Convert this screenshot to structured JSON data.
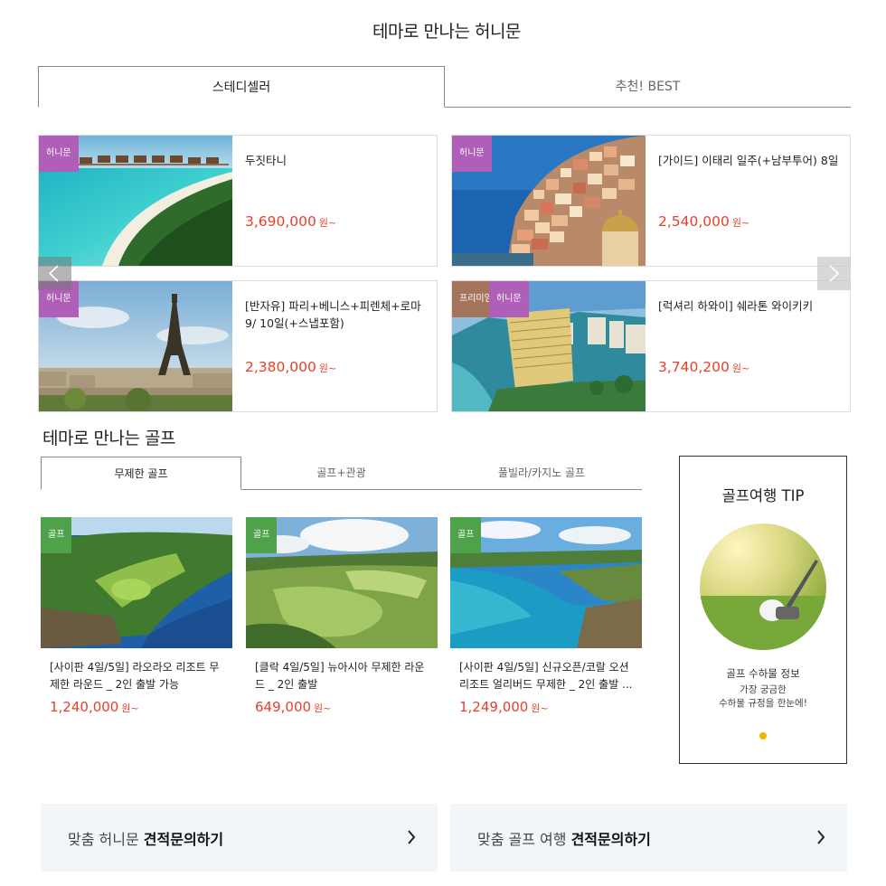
{
  "honeymoon": {
    "title": "테마로 만나는 허니문",
    "tabs": [
      "스테디셀러",
      "추천! BEST"
    ],
    "cards": [
      {
        "badges": [
          "허니문"
        ],
        "title": "두짓타니",
        "price": "3,690,000",
        "won": "원~"
      },
      {
        "badges": [
          "허니문"
        ],
        "title": "[가이드] 이태리 일주(+남부투어) 8일",
        "price": "2,540,000",
        "won": "원~"
      },
      {
        "badges": [
          "허니문"
        ],
        "title": "[반자유] 파리+베니스+피렌체+로마 9/ 10일(+스냅포함)",
        "price": "2,380,000",
        "won": "원~"
      },
      {
        "badges": [
          "프리미엄",
          "허니문"
        ],
        "title": "[럭셔리 하와이] 쉐라톤 와이키키",
        "price": "3,740,200",
        "won": "원~"
      }
    ]
  },
  "golf": {
    "title": "테마로 만나는 골프",
    "tabs": [
      "무제한 골프",
      "골프+관광",
      "풀빌라/카지노 골프"
    ],
    "cards": [
      {
        "badge": "골프",
        "title": "[사이판 4일/5일] 라오라오 리조트 무제한 라운드 _ 2인 출발 가능",
        "price": "1,240,000",
        "won": "원~"
      },
      {
        "badge": "골프",
        "title": "[클락 4일/5일] 뉴아시아 무제한 라운드 _ 2인 출발",
        "price": "649,000",
        "won": "원~"
      },
      {
        "badge": "골프",
        "title": "[사이판 4일/5일] 신규오픈/코랄 오션 리조트 얼리버드 무제한 _ 2인 출발 ...",
        "price": "1,249,000",
        "won": "원~"
      }
    ],
    "tip": {
      "title": "골프여행 TIP",
      "subtitle": "골프 수하물 정보",
      "desc_line1": "가장 궁금한",
      "desc_line2": "수하물 규정을 한눈에!"
    }
  },
  "cta": [
    {
      "prefix": "맞춤 허니문 ",
      "bold": "견적문의하기"
    },
    {
      "prefix": "맞춤 골프 여행 ",
      "bold": "견적문의하기"
    }
  ],
  "colors": {
    "price": "#e8402c",
    "honeymoon_badge": "#b05fb8",
    "premium_badge": "#a5745c",
    "golf_badge": "#4fa14a",
    "tip_dot": "#f0b400"
  }
}
